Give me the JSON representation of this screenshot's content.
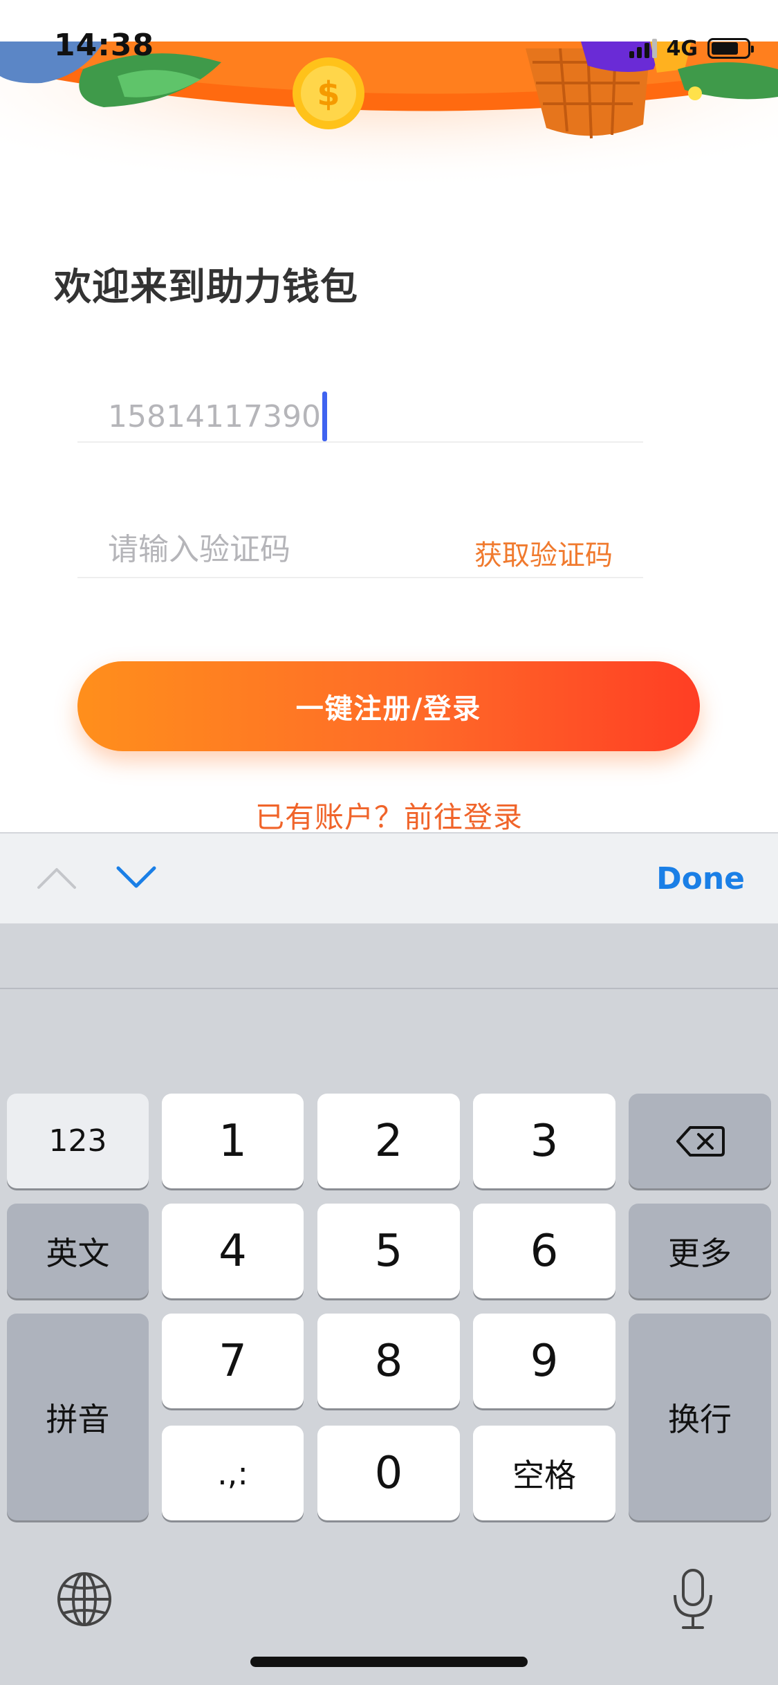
{
  "status_bar": {
    "time": "14:38",
    "network": "4G",
    "battery_level": 0.75
  },
  "welcome": {
    "title": "欢迎来到助力钱包"
  },
  "form": {
    "phone_value": "15814117390",
    "code_placeholder": "请输入验证码",
    "get_code_label": "获取验证码",
    "submit_label": "一键注册/登录",
    "login_link": "已有账户？前往登录"
  },
  "accessory": {
    "done_label": "Done",
    "up_icon": "chevron-up-icon",
    "down_icon": "chevron-down-icon"
  },
  "keyboard": {
    "key_123": "123",
    "key_english": "英文",
    "key_pinyin": "拼音",
    "key_more": "更多",
    "key_return": "换行",
    "key_space": "空格",
    "key_punct": ".,:",
    "digits": [
      "1",
      "2",
      "3",
      "4",
      "5",
      "6",
      "7",
      "8",
      "9",
      "0"
    ],
    "backspace_icon": "backspace-icon",
    "globe_icon": "globe-icon",
    "mic_icon": "microphone-icon"
  },
  "colors": {
    "accent_orange": "#f07a2e",
    "button_gradient_start": "#ff8f1c",
    "button_gradient_end": "#ff3e24",
    "caret_blue": "#3f63f0",
    "done_blue": "#1a7fe6"
  }
}
